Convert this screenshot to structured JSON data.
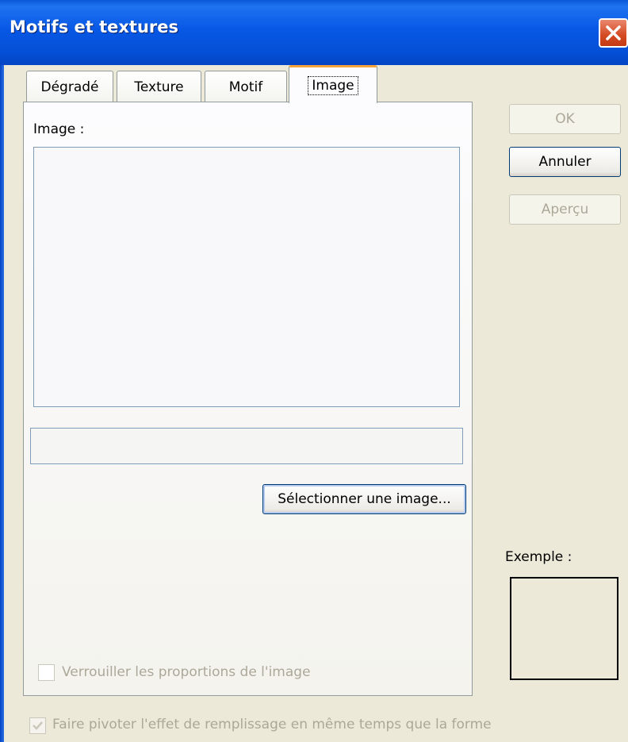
{
  "window": {
    "title": "Motifs et textures"
  },
  "tabs": [
    {
      "label": "Dégradé"
    },
    {
      "label": "Texture"
    },
    {
      "label": "Motif"
    },
    {
      "label": "Image"
    }
  ],
  "image_tab": {
    "image_label": "Image :",
    "select_button_label": "Sélectionner une image...",
    "lock_proportions_label": "Verrouiller les proportions de l'image",
    "lock_proportions_checked": false
  },
  "buttons": {
    "ok": "OK",
    "cancel": "Annuler",
    "preview": "Aperçu"
  },
  "example_label": "Exemple :",
  "rotate_fill": {
    "label": "Faire pivoter l'effet de remplissage en même temps que la forme",
    "checked": true
  },
  "colors": {
    "title_blue": "#0450d6",
    "dialog_bg": "#ece9d8",
    "active_tab_accent": "#f7a33b",
    "disabled_text": "#aca899"
  }
}
